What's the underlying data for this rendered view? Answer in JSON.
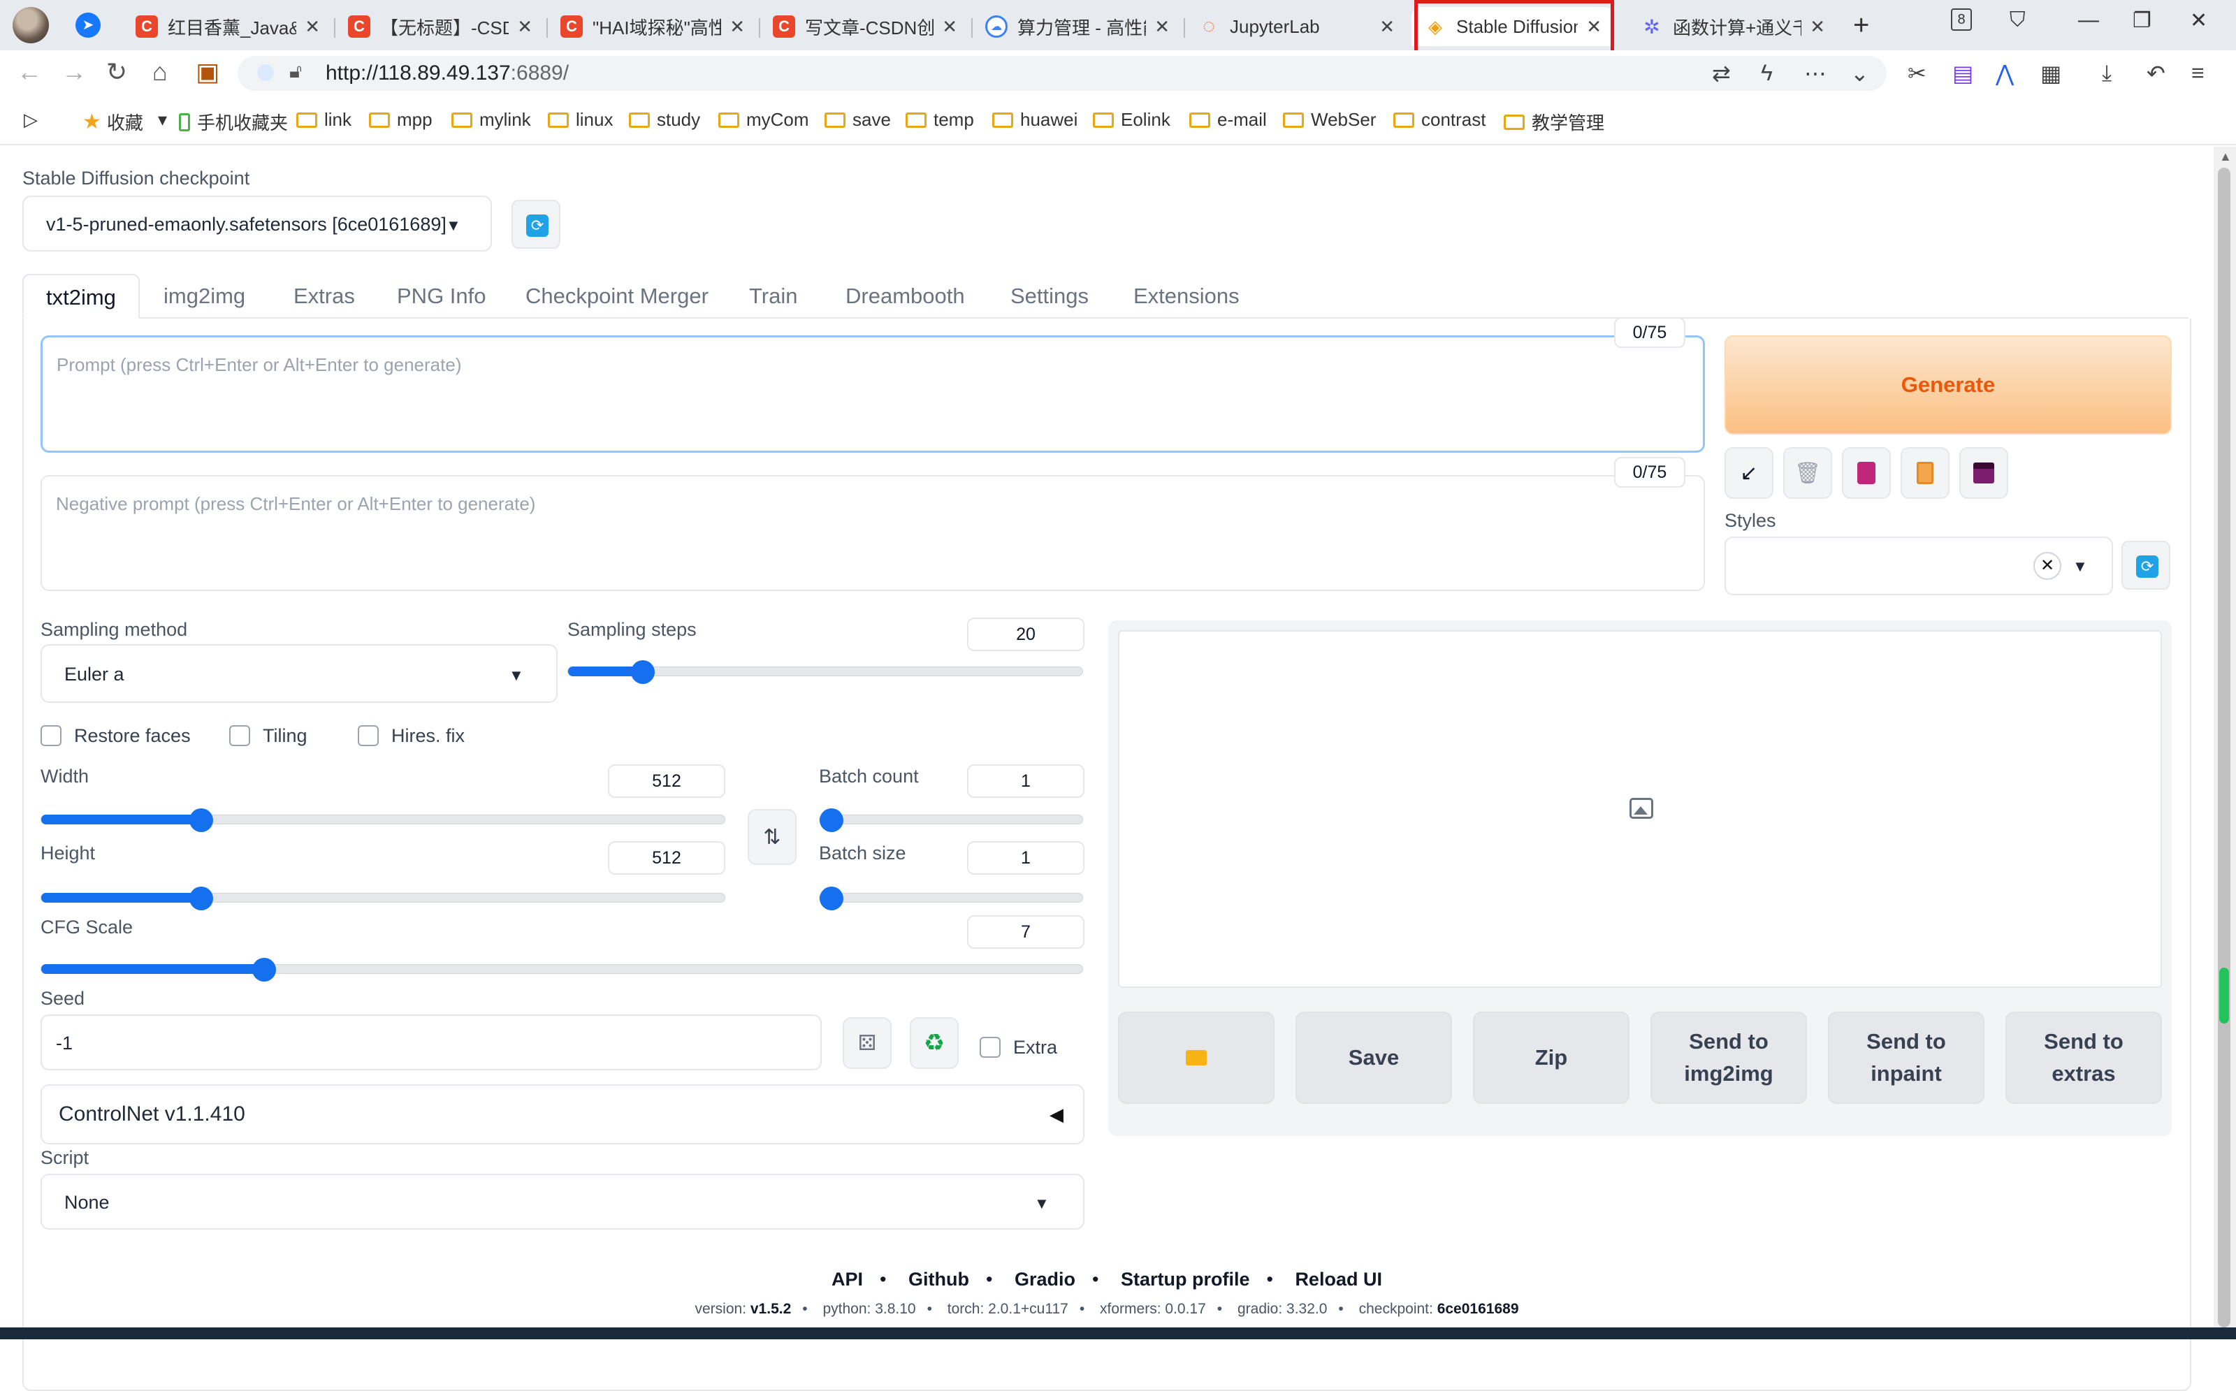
{
  "browser": {
    "tabs": [
      {
        "title": "红目香薰_Java&",
        "icon": "csdn-icon"
      },
      {
        "title": "【无标题】-CSD",
        "icon": "csdn-icon"
      },
      {
        "title": "\"HAI域探秘\"高性",
        "icon": "csdn-icon"
      },
      {
        "title": "写文章-CSDN创作",
        "icon": "csdn-icon"
      },
      {
        "title": "算力管理 - 高性能",
        "icon": "cloud-icon"
      },
      {
        "title": "JupyterLab",
        "icon": "jupyter-icon"
      },
      {
        "title": "Stable Diffusion",
        "icon": "layers-icon",
        "active": true
      },
      {
        "title": "函数计算+通义千",
        "icon": "tongyi-icon"
      }
    ],
    "tab_count_badge": "8",
    "url_host": "http://118.89.49.137",
    "url_port_path": ":6889/",
    "bookmarks": [
      "收藏",
      "手机收藏夹",
      "link",
      "mpp",
      "mylink",
      "linux",
      "study",
      "myCom",
      "save",
      "temp",
      "huawei",
      "Eolink",
      "e-mail",
      "WebSer",
      "contrast",
      "教学管理"
    ]
  },
  "checkpoint": {
    "label": "Stable Diffusion checkpoint",
    "value": "v1-5-pruned-emaonly.safetensors [6ce0161689]"
  },
  "tabs": [
    "txt2img",
    "img2img",
    "Extras",
    "PNG Info",
    "Checkpoint Merger",
    "Train",
    "Dreambooth",
    "Settings",
    "Extensions"
  ],
  "prompt": {
    "placeholder": "Prompt (press Ctrl+Enter or Alt+Enter to generate)",
    "counter": "0/75"
  },
  "negative_prompt": {
    "placeholder": "Negative prompt (press Ctrl+Enter or Alt+Enter to generate)",
    "counter": "0/75"
  },
  "generate_label": "Generate",
  "styles_label": "Styles",
  "sampling": {
    "method_label": "Sampling method",
    "method_value": "Euler a",
    "steps_label": "Sampling steps",
    "steps_value": "20",
    "steps_fraction": 0.13
  },
  "checkboxes": {
    "restore_faces": "Restore faces",
    "tiling": "Tiling",
    "hires_fix": "Hires. fix"
  },
  "size": {
    "width_label": "Width",
    "width_value": "512",
    "height_label": "Height",
    "height_value": "512",
    "batch_count_label": "Batch count",
    "batch_count_value": "1",
    "batch_size_label": "Batch size",
    "batch_size_value": "1"
  },
  "cfg": {
    "label": "CFG Scale",
    "value": "7"
  },
  "seed": {
    "label": "Seed",
    "value": "-1",
    "extra_label": "Extra"
  },
  "controlnet_label": "ControlNet v1.1.410",
  "script": {
    "label": "Script",
    "value": "None"
  },
  "output_buttons": [
    "Save",
    "Zip",
    "Send to img2img",
    "Send to inpaint",
    "Send to extras"
  ],
  "footer": {
    "links": [
      "API",
      "Github",
      "Gradio",
      "Startup profile",
      "Reload UI"
    ],
    "version_label": "version:",
    "version": "v1.5.2",
    "python_label": "python:",
    "python": "3.8.10",
    "torch_label": "torch:",
    "torch": "2.0.1+cu117",
    "xformers_label": "xformers:",
    "xformers": "0.0.17",
    "gradio_label": "gradio:",
    "gradio": "3.32.0",
    "checkpoint_label": "checkpoint:",
    "checkpoint": "6ce0161689"
  },
  "colors": {
    "accent": "#1570ef",
    "generate_text": "#ea580c",
    "highlight_box": "#e0191d"
  }
}
